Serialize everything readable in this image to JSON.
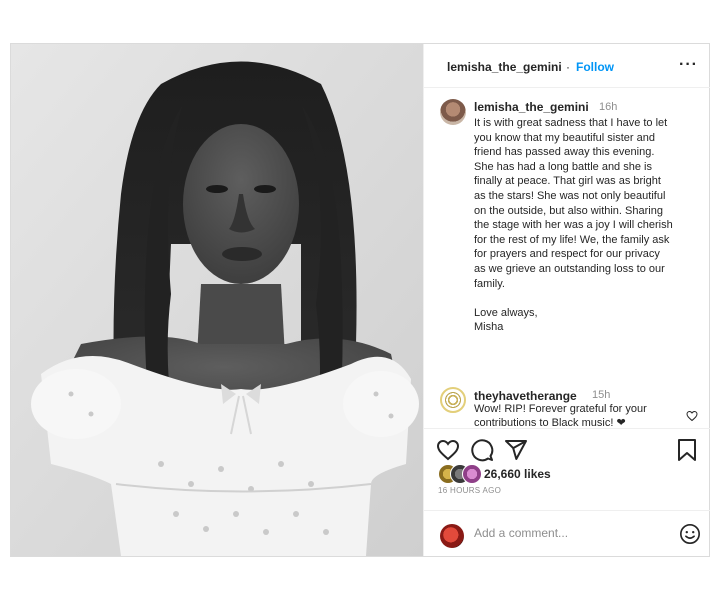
{
  "header": {
    "username": "lemisha_the_gemini",
    "separator": "·",
    "follow_label": "Follow",
    "more_label": "···"
  },
  "caption": {
    "username": "lemisha_the_gemini",
    "time": "16h",
    "lines": [
      "It is with great sadness that I have to let",
      "you know that my beautiful sister and",
      "friend has passed away this evening.",
      "She has had a long battle and she is",
      "finally at peace. That girl was as bright",
      "as the stars! She was not only beautiful",
      "on the outside, but also within. Sharing",
      "the stage with her was a joy I will cherish",
      "for the rest of my life! We, the family ask",
      "for prayers and respect for our privacy",
      "as we grieve an outstanding loss to our",
      "family."
    ],
    "signoff": [
      "Love always,",
      "Misha"
    ]
  },
  "comment": {
    "username": "theyhavetherange",
    "time": "15h",
    "lines": [
      "Wow! RIP! Forever grateful for your",
      "contributions to Black music! ❤"
    ]
  },
  "likes": {
    "text": "26,660 likes"
  },
  "time_ago": "16 HOURS AGO",
  "add_comment": {
    "placeholder": "Add a comment..."
  },
  "icons": {
    "heart": "heart-icon",
    "comment": "comment-icon",
    "share": "share-icon",
    "save": "bookmark-icon",
    "emoji": "emoji-icon",
    "comment_like": "heart-icon"
  },
  "colors": {
    "link_blue": "#0095f6",
    "text": "#262626",
    "muted": "#8e8e8e",
    "border": "#dbdbdb"
  }
}
